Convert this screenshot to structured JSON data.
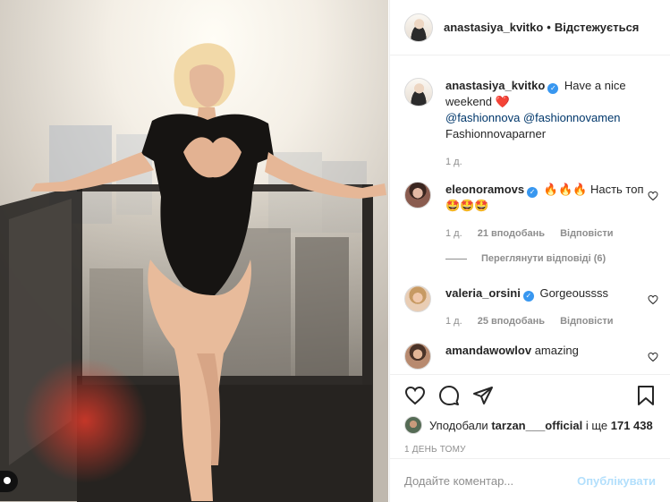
{
  "header": {
    "username": "anastasiya_kvitko",
    "separator": "•",
    "follow_label": "Відстежується"
  },
  "caption": {
    "username": "anastasiya_kvitko",
    "text_1": "Have a nice weekend",
    "emoji": "❤️",
    "mention_1": "@fashionnova",
    "mention_2": "@fashionnovamen",
    "text_2": "Fashionnovaparner",
    "time": "1 д."
  },
  "comments": [
    {
      "username": "eleonoramovs",
      "text": "🔥🔥🔥 Насть топ 🤩🤩🤩",
      "time": "1 д.",
      "likes": "21 вподобань",
      "reply": "Відповісти",
      "view_replies": "Переглянути відповіді (6)"
    },
    {
      "username": "valeria_orsini",
      "text": "Gorgeoussss",
      "time": "1 д.",
      "likes": "25 вподобань",
      "reply": "Відповісти"
    },
    {
      "username": "amandawowlov",
      "text": "amazing"
    }
  ],
  "likes": {
    "prefix": "Уподобали",
    "user": "tarzan___official",
    "middle": "і ще",
    "count": "171 438"
  },
  "timestamp": "1 ДЕНЬ ТОМУ",
  "add_comment": {
    "placeholder": "Додайте коментар...",
    "post_label": "Опублікувати"
  },
  "icons": {
    "like": "heart-icon",
    "comment": "comment-icon",
    "share": "paper-plane-icon",
    "save": "bookmark-icon",
    "verified": "verified-badge-icon",
    "user_tag": "user-tag-icon"
  },
  "colors": {
    "verified_blue": "#3897f0",
    "mention_blue": "#00376b",
    "post_button_disabled": "#b2dffc",
    "meta_gray": "#8e8e8e"
  }
}
